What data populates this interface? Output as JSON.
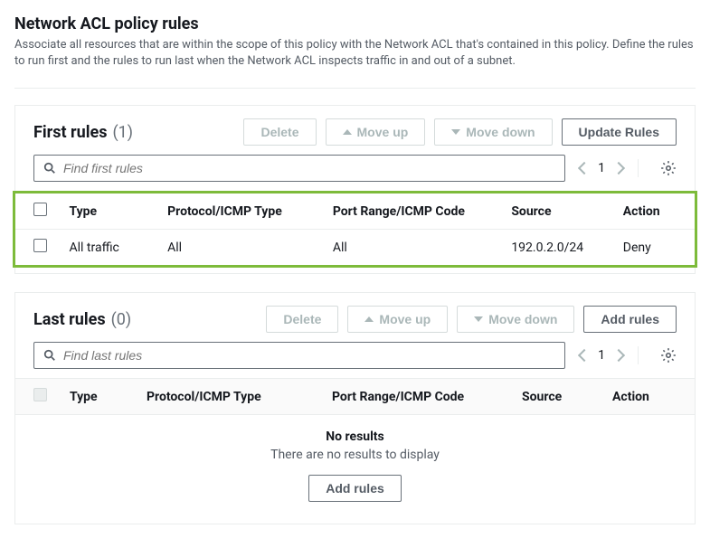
{
  "header": {
    "title": "Network ACL policy rules",
    "description": "Associate all resources that are within the scope of this policy with the Network ACL that's contained in this policy. Define the rules to run first and the rules to run last when the Network ACL inspects traffic in and out of a subnet."
  },
  "columns": {
    "type": "Type",
    "protocol": "Protocol/ICMP Type",
    "port": "Port Range/ICMP Code",
    "source": "Source",
    "action": "Action"
  },
  "first": {
    "title": "First rules",
    "count": "(1)",
    "btn_delete": "Delete",
    "btn_up": "Move up",
    "btn_down": "Move down",
    "btn_update": "Update Rules",
    "search_placeholder": "Find first rules",
    "page": "1",
    "rows": [
      {
        "type": "All traffic",
        "protocol": "All",
        "port": "All",
        "source": "192.0.2.0/24",
        "action": "Deny"
      }
    ]
  },
  "last": {
    "title": "Last rules",
    "count": "(0)",
    "btn_delete": "Delete",
    "btn_up": "Move up",
    "btn_down": "Move down",
    "btn_add": "Add rules",
    "search_placeholder": "Find last rules",
    "page": "1",
    "empty_title": "No results",
    "empty_sub": "There are no results to display",
    "empty_btn": "Add rules"
  }
}
